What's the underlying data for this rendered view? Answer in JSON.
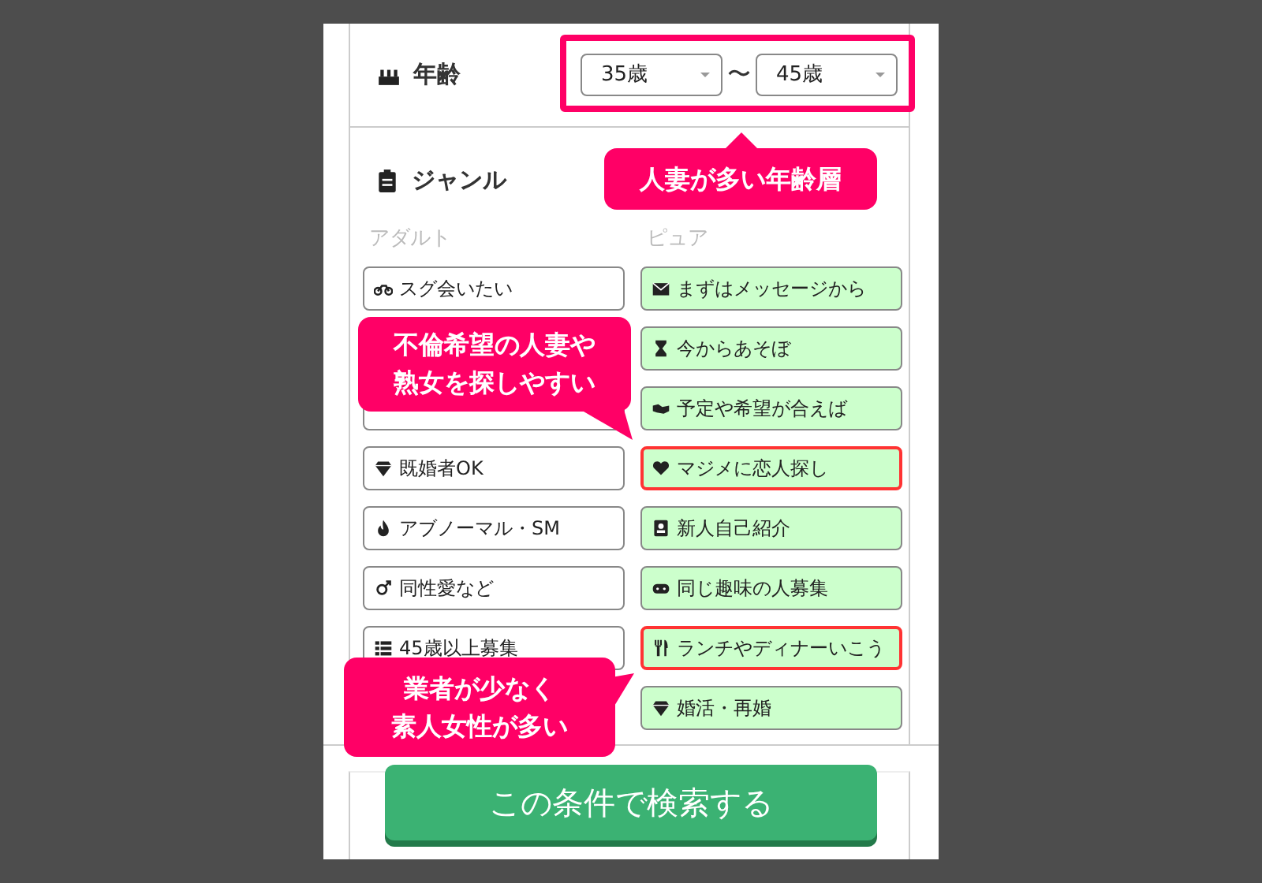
{
  "age": {
    "label": "年齢",
    "from": "35歳",
    "separator": "〜",
    "to": "45歳"
  },
  "genre": {
    "label": "ジャンル",
    "columns": [
      {
        "kind": "adult",
        "heading": "アダルト",
        "items": [
          {
            "label": "スグ会いたい",
            "highlighted": false
          },
          {
            "kind": "covered"
          },
          {
            "kind": "blank"
          },
          {
            "label": "既婚者OK",
            "highlighted": false
          },
          {
            "label": "アブノーマル・SM",
            "highlighted": false
          },
          {
            "label": "同性愛など",
            "highlighted": false
          },
          {
            "label": "45歳以上募集",
            "highlighted": false
          }
        ]
      },
      {
        "kind": "pure",
        "heading": "ピュア",
        "items": [
          {
            "label": "まずはメッセージから",
            "highlighted": false
          },
          {
            "label": "今からあそぼ",
            "highlighted": false
          },
          {
            "label": "予定や希望が合えば",
            "highlighted": false
          },
          {
            "label": "マジメに恋人探し",
            "highlighted": true
          },
          {
            "label": "新人自己紹介",
            "highlighted": false
          },
          {
            "label": "同じ趣味の人募集",
            "highlighted": false
          },
          {
            "label": "ランチやディナーいこう",
            "highlighted": true
          },
          {
            "label": "婚活・再婚",
            "highlighted": false
          }
        ]
      }
    ]
  },
  "search_button": "この条件で検索する",
  "annotations": [
    {
      "kind": "frame"
    },
    {
      "kind": "callout",
      "lines": [
        "人妻が多い年齢層"
      ]
    },
    {
      "kind": "callout",
      "lines": [
        "不倫希望の人妻や",
        "熟女を探しやすい"
      ]
    },
    {
      "kind": "callout",
      "lines": [
        "業者が少なく",
        "素人女性が多い"
      ]
    }
  ]
}
